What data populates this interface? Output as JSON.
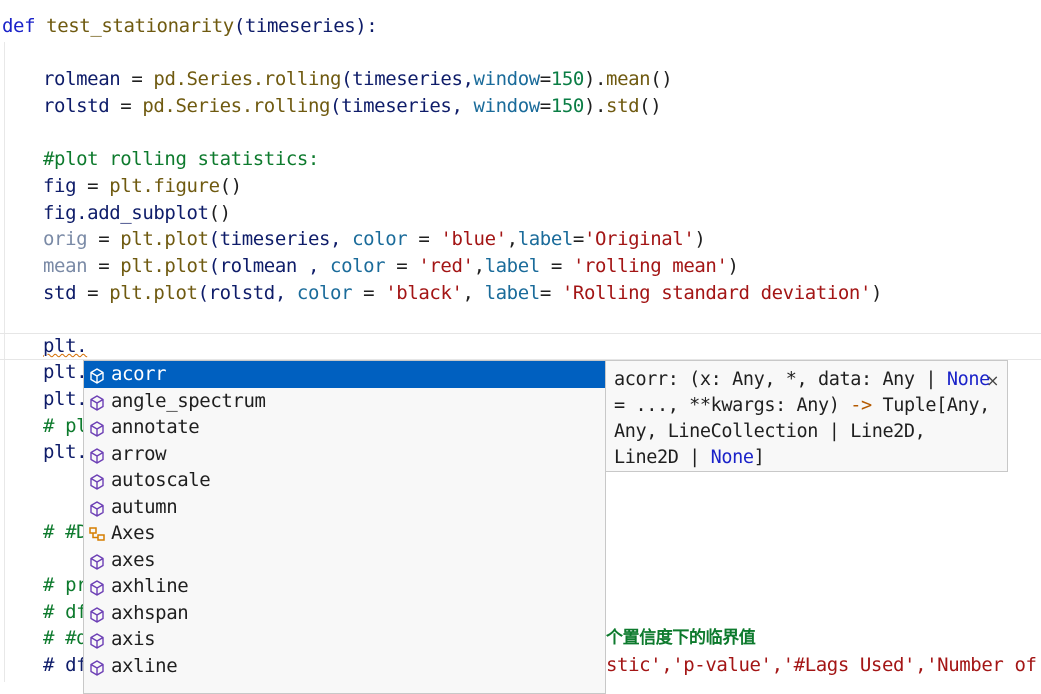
{
  "editor": {
    "code_lines": {
      "def_kw": "def",
      "func_name": "test_stationarity",
      "def_rest": "(timeseries):",
      "l2_a": "rolmean",
      "l2_b": " = ",
      "l2_c": "pd.Series.rolling",
      "l2_d": "(timeseries,",
      "l2_e": "window",
      "l2_f": "=",
      "l2_g": "150",
      "l2_h": ").",
      "l2_i": "mean",
      "l2_j": "()",
      "l3_a": "rolstd",
      "l3_b": " = ",
      "l3_c": "pd.Series.rolling",
      "l3_d": "(timeseries, ",
      "l3_e": "window",
      "l3_f": "=",
      "l3_g": "150",
      "l3_h": ").",
      "l3_i": "std",
      "l3_j": "()",
      "comment_plot": "#plot rolling statistics:",
      "fig_a": "fig",
      "fig_b": " = ",
      "fig_c": "plt.figure",
      "fig_d": "()",
      "addsub_a": "fig.add_subplot",
      "addsub_b": "()",
      "orig_a": "orig",
      "orig_b": " = ",
      "orig_c": "plt.plot",
      "orig_d": "(timeseries, ",
      "orig_e": "color",
      "orig_f": " = ",
      "orig_g": "'blue'",
      "orig_h": ",",
      "orig_i": "label",
      "orig_j": "=",
      "orig_k": "'Original'",
      "orig_l": ")",
      "mean_a": "mean",
      "mean_b": " = ",
      "mean_c": "plt.plot",
      "mean_d": "(rolmean , ",
      "mean_e": "color",
      "mean_f": " = ",
      "mean_g": "'red'",
      "mean_h": ",",
      "mean_i": "label",
      "mean_j": " = ",
      "mean_k": "'rolling mean'",
      "mean_l": ")",
      "std_a": "std",
      "std_b": " = ",
      "std_c": "plt.plot",
      "std_d": "(rolstd, ",
      "std_e": "color",
      "std_f": " = ",
      "std_g": "'black'",
      "std_h": ", ",
      "std_i": "label",
      "std_j": "= ",
      "std_k": "'Rolling standard deviation'",
      "std_l": ")",
      "typing": "plt.",
      "hidden_1": "plt.",
      "hidden_2": "plt.",
      "hidden_3": "# pl",
      "hidden_4": "plt.",
      "hidden_5": "# #D",
      "hidden_6": "# pr",
      "hidden_7": "# df",
      "hidden_8": "# #d",
      "hidden_9": "# df",
      "cjk_comment": "个置信度下的临界值",
      "last_line_tail": "stic','p-value','#Lags Used','Number of Obs"
    }
  },
  "suggest": {
    "items": [
      {
        "label": "acorr",
        "icon": "method-cube-icon"
      },
      {
        "label": "angle_spectrum",
        "icon": "method-cube-icon"
      },
      {
        "label": "annotate",
        "icon": "method-cube-icon"
      },
      {
        "label": "arrow",
        "icon": "method-cube-icon"
      },
      {
        "label": "autoscale",
        "icon": "method-cube-icon"
      },
      {
        "label": "autumn",
        "icon": "method-cube-icon"
      },
      {
        "label": "Axes",
        "icon": "class-icon"
      },
      {
        "label": "axes",
        "icon": "method-cube-icon"
      },
      {
        "label": "axhline",
        "icon": "method-cube-icon"
      },
      {
        "label": "axhspan",
        "icon": "method-cube-icon"
      },
      {
        "label": "axis",
        "icon": "method-cube-icon"
      },
      {
        "label": "axline",
        "icon": "method-cube-icon"
      }
    ],
    "selected_index": 0
  },
  "details": {
    "l1_a": "acorr: (x: Any, *, data: Any | ",
    "l1_none": "None",
    "l2_a": "= ..., **kwargs: Any) ",
    "l2_arrow": "->",
    "l2_b": " Tuple[Any,",
    "l3": "Any, LineCollection | Line2D,",
    "l4_a": "Line2D | ",
    "l4_none": "None",
    "l4_b": "]",
    "close_glyph": "×"
  },
  "colors": {
    "selection": "#0060c0",
    "keyword": "#1a22c9",
    "string": "#a31515",
    "number": "#0a7d44",
    "comment": "#0d7a2d"
  }
}
